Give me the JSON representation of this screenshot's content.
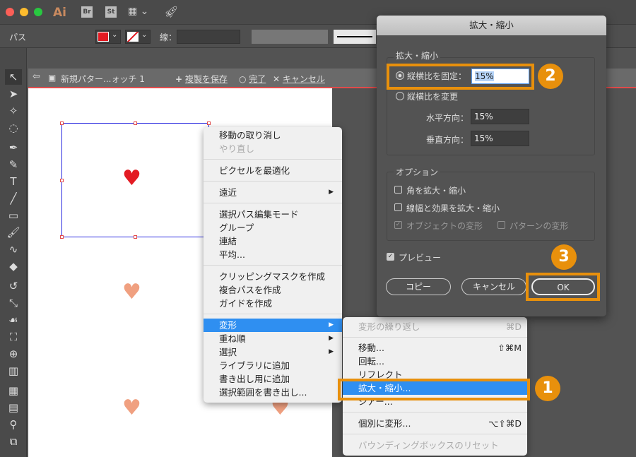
{
  "app": {
    "logo": "Ai",
    "bridge": "Br",
    "stock": "St"
  },
  "control_bar": {
    "object_type": "パス",
    "fill_color": "#e31b23",
    "stroke_label": "線："
  },
  "pattern_bar": {
    "name": "新規パター...ォッチ 1",
    "save_copy": "複製を保存",
    "done": "完了",
    "cancel": "キャンセル"
  },
  "canvas": {
    "heart_selected_color": "#e31b23",
    "heart_color": "#f0a080"
  },
  "context_menu": {
    "items": [
      {
        "label": "移動の取り消し"
      },
      {
        "label": "やり直し",
        "disabled": true
      },
      {
        "label": "ピクセルを最適化"
      },
      {
        "label": "遠近",
        "submenu": true
      },
      {
        "label": "選択パス編集モード"
      },
      {
        "label": "グループ"
      },
      {
        "label": "連結"
      },
      {
        "label": "平均..."
      },
      {
        "label": "クリッピングマスクを作成"
      },
      {
        "label": "複合パスを作成"
      },
      {
        "label": "ガイドを作成"
      },
      {
        "label": "変形",
        "submenu": true,
        "highlighted": true
      },
      {
        "label": "重ね順",
        "submenu": true
      },
      {
        "label": "選択",
        "submenu": true
      },
      {
        "label": "ライブラリに追加"
      },
      {
        "label": "書き出し用に追加"
      },
      {
        "label": "選択範囲を書き出し..."
      }
    ]
  },
  "transform_submenu": {
    "items": [
      {
        "label": "変形の繰り返し",
        "shortcut": "⌘D",
        "disabled": true
      },
      {
        "label": "移動...",
        "shortcut": "⇧⌘M"
      },
      {
        "label": "回転..."
      },
      {
        "label": "リフレクト"
      },
      {
        "label": "拡大・縮小...",
        "highlighted": true
      },
      {
        "label": "シアー..."
      },
      {
        "label": "個別に変形...",
        "shortcut": "⌥⇧⌘D"
      },
      {
        "label": "バウンディングボックスのリセット",
        "disabled": true
      }
    ]
  },
  "dialog": {
    "title": "拡大・縮小",
    "scale_group": "拡大・縮小",
    "uniform_label": "縦横比を固定：",
    "uniform_value": "15%",
    "nonuniform_label": "縦横比を変更",
    "horizontal_label": "水平方向：",
    "horizontal_value": "15%",
    "vertical_label": "垂直方向：",
    "vertical_value": "15%",
    "options_group": "オプション",
    "scale_corners": "角を拡大・縮小",
    "scale_strokes": "線幅と効果を拡大・縮小",
    "transform_objects": "オブジェクトの変形",
    "transform_patterns": "パターンの変形",
    "preview": "プレビュー",
    "copy": "コピー",
    "cancel": "キャンセル",
    "ok": "OK"
  },
  "annotations": {
    "step1": "1",
    "step2": "2",
    "step3": "3",
    "color": "#e8900c"
  }
}
